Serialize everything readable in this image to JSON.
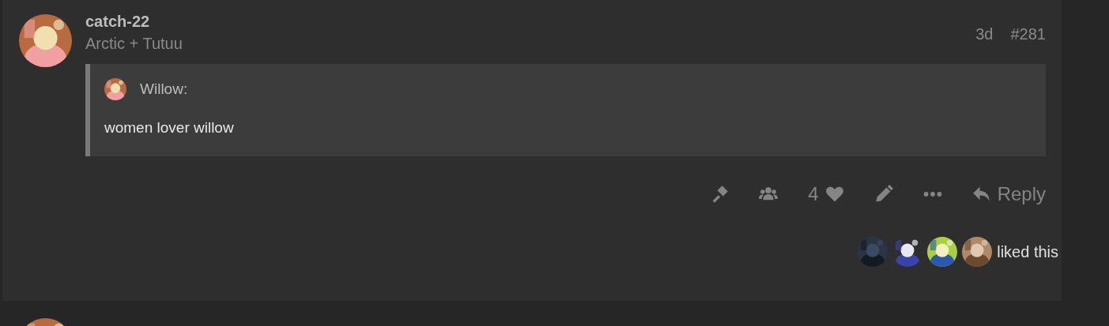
{
  "post": {
    "username": "catch-22",
    "user_title": "Arctic + Tutuu",
    "age": "3d",
    "post_number": "#281",
    "quote": {
      "author": "Willow:",
      "text": "women lover willow"
    },
    "actions": [
      {
        "kind": "admin"
      },
      {
        "kind": "group"
      },
      {
        "kind": "like",
        "count": "4"
      },
      {
        "kind": "edit"
      },
      {
        "kind": "more"
      },
      {
        "kind": "reply",
        "label": "Reply"
      }
    ],
    "liked_text": "liked this"
  }
}
